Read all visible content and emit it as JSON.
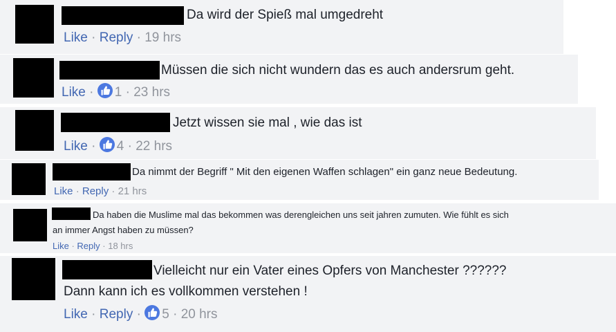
{
  "comments": [
    {
      "text": "Da wird der Spieß mal umgedreht",
      "like": "Like",
      "reply": "Reply",
      "time": "19 hrs",
      "reactions": ""
    },
    {
      "text": "Müssen die sich nicht wundern das es auch andersrum geht.",
      "like": "Like",
      "reply": "Reply",
      "time": "23 hrs",
      "reactions": "1"
    },
    {
      "text": "Jetzt wissen sie mal , wie das ist",
      "like": "Like",
      "reply": "Reply",
      "time": "22 hrs",
      "reactions": "4"
    },
    {
      "text": "Da nimmt der Begriff \" Mit den eigenen Waffen schlagen\" ein ganz neue Bedeutung.",
      "like": "Like",
      "reply": "Reply",
      "time": "21 hrs",
      "reactions": ""
    },
    {
      "text_line1": "Da haben die Muslime mal das bekommen was derengleichen uns seit jahren zumuten. Wie fühlt es sich",
      "text_line2": "an immer Angst haben zu müssen?",
      "like": "Like",
      "reply": "Reply",
      "time": "18 hrs",
      "reactions": ""
    },
    {
      "text_line1": "Vielleicht nur ein Vater eines Opfers von Manchester ??????",
      "text_line2": "Dann kann ich es vollkommen verstehen !",
      "like": "Like",
      "reply": "Reply",
      "time": "20 hrs",
      "reactions": "5"
    }
  ],
  "separator": " · ",
  "colors": {
    "link": "#4267b2",
    "meta": "#90949c",
    "badge": "#4c78e0",
    "crop_bg": "#f2f3f5"
  },
  "icons": {
    "reaction": "thumbs-up-icon"
  }
}
